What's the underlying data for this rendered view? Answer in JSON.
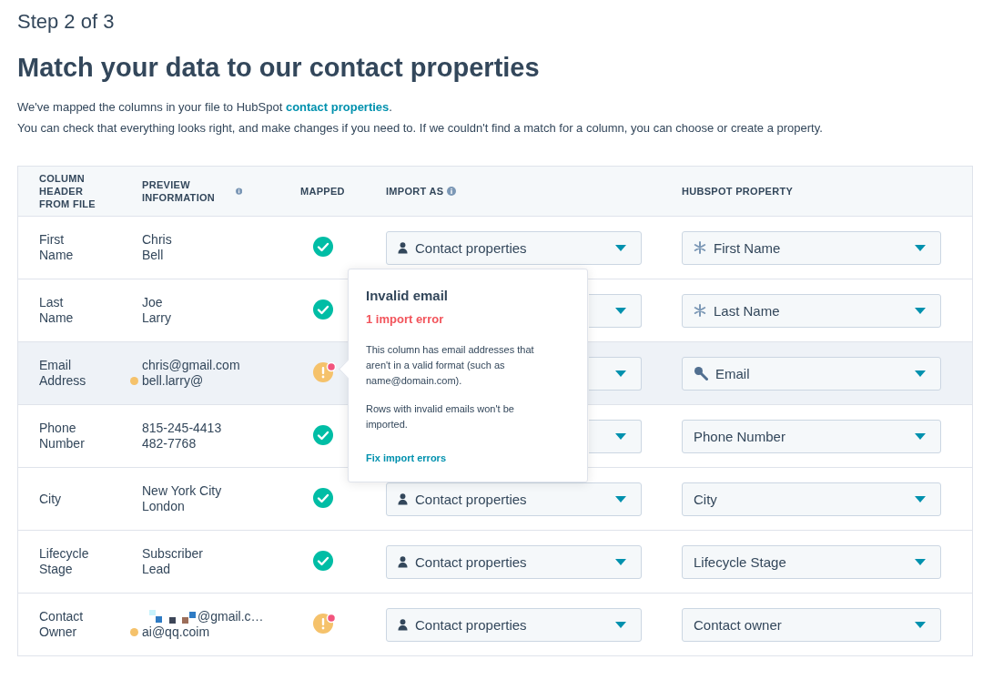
{
  "step": "Step 2 of 3",
  "title": "Match your data to our contact properties",
  "intro": "We've mapped the columns in your file to HubSpot **contact properties**.",
  "intro_2": "You can check that everything looks right, and make changes if you need to. If we couldn't find a match for a column, you can choose or create a property.",
  "table": {
    "columns": [
      {
        "label": "COLUMN HEADER FROM FILE",
        "info": false
      },
      {
        "label": "PREVIEW INFORMATION",
        "info": true
      },
      {
        "label": "MAPPED",
        "info": false
      },
      {
        "label": "IMPORT AS",
        "info": true
      },
      {
        "label": "HUBSPOT PROPERTY",
        "info": false
      }
    ],
    "rows": [
      {
        "header": "First Name",
        "preview": [
          {
            "text": "Chris",
            "invalid": false
          },
          {
            "text": "Bell",
            "invalid": false
          }
        ],
        "mapped": true,
        "selected": false,
        "import_as": "Contact properties",
        "property": {
          "label": "First Name",
          "kind": "required"
        }
      },
      {
        "header": "Last Name",
        "preview": [
          {
            "text": "Joe",
            "invalid": false
          },
          {
            "text": "Larry",
            "invalid": false
          }
        ],
        "mapped": true,
        "selected": false,
        "property": {
          "label": "Last Name",
          "kind": "required"
        }
      },
      {
        "header": "Email Address",
        "preview": [
          {
            "text": "chris@gmail.com",
            "invalid": false
          },
          {
            "text": "bell.larry@",
            "invalid": true
          }
        ],
        "mapped": false,
        "selected": true,
        "property": {
          "label": "Email",
          "kind": "key"
        }
      },
      {
        "header": "Phone Number",
        "preview": [
          {
            "text": "815-245-4413",
            "invalid": false
          },
          {
            "text": "482-7768",
            "invalid": false
          }
        ],
        "mapped": true,
        "selected": false,
        "property": {
          "label": "Phone Number",
          "kind": "plain"
        }
      },
      {
        "header": "City",
        "preview": [
          {
            "text": "New York City",
            "invalid": false
          },
          {
            "text": "London",
            "invalid": false
          }
        ],
        "mapped": true,
        "selected": false,
        "import_as": "Contact properties",
        "property": {
          "label": "City",
          "kind": "plain"
        }
      },
      {
        "header": "Lifecycle Stage",
        "preview": [
          {
            "text": "Subscriber",
            "invalid": false
          },
          {
            "text": "Lead",
            "invalid": false
          }
        ],
        "mapped": true,
        "selected": false,
        "import_as": "Contact properties",
        "property": {
          "label": "Lifecycle Stage",
          "kind": "plain"
        }
      },
      {
        "header": "Contact Owner",
        "preview": [
          {
            "text": "@gmail.c…",
            "invalid": false,
            "redacted": true
          },
          {
            "text": "ai@qq.coim",
            "invalid": true
          }
        ],
        "mapped": false,
        "selected": false,
        "import_as": "Contact properties",
        "property": {
          "label": "Contact owner",
          "kind": "plain"
        }
      }
    ]
  },
  "popover": {
    "title": "Invalid email",
    "error": "1 import error",
    "body": "This column has email addresses that aren't in a valid format (such as name@domain.com).",
    "body_2": "Rows with invalid emails won't be imported.",
    "link": "Fix import errors"
  }
}
